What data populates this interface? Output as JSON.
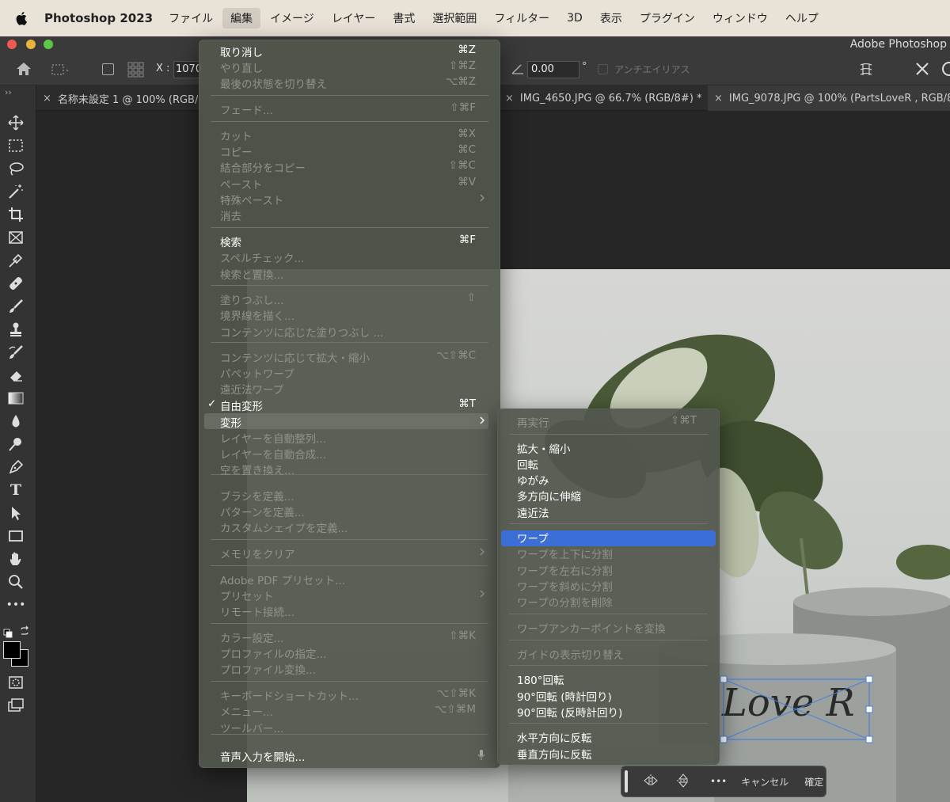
{
  "menubar": {
    "app_name": "Photoshop 2023",
    "items": [
      "ファイル",
      "編集",
      "イメージ",
      "レイヤー",
      "書式",
      "選択範囲",
      "フィルター",
      "3D",
      "表示",
      "プラグイン",
      "ウィンドウ",
      "ヘルプ"
    ]
  },
  "window": {
    "title": "Adobe Photoshop"
  },
  "options": {
    "x_label": "X :",
    "x_value": "1070.",
    "angle_value": "0.00",
    "degree": "°",
    "antialias": "アンチエイリアス"
  },
  "tabs": [
    {
      "close": "×",
      "label": "名称未設定 1 @ 100% (RGB/"
    },
    {
      "close": "×",
      "label": "IMG_4650.JPG @ 66.7% (RGB/8#) *"
    },
    {
      "close": "×",
      "label": "IMG_9078.JPG @ 100% (PartsLoveR , RGB/8"
    }
  ],
  "edit_menu": [
    {
      "label": "取り消し",
      "shortcut": "⌘Z",
      "enabled": true
    },
    {
      "label": "やり直し",
      "shortcut": "⇧⌘Z",
      "enabled": false
    },
    {
      "label": "最後の状態を切り替え",
      "shortcut": "⌥⌘Z",
      "enabled": false
    },
    {
      "label": "フェード...",
      "shortcut": "⇧⌘F",
      "enabled": false
    },
    {
      "label": "カット",
      "shortcut": "⌘X",
      "enabled": false
    },
    {
      "label": "コピー",
      "shortcut": "⌘C",
      "enabled": false
    },
    {
      "label": "結合部分をコピー",
      "shortcut": "⇧⌘C",
      "enabled": false
    },
    {
      "label": "ペースト",
      "shortcut": "⌘V",
      "enabled": false
    },
    {
      "label": "特殊ペースト",
      "shortcut": "",
      "enabled": false,
      "submenu": true
    },
    {
      "label": "消去",
      "shortcut": "",
      "enabled": false
    },
    {
      "label": "検索",
      "shortcut": "⌘F",
      "enabled": true
    },
    {
      "label": "スペルチェック...",
      "shortcut": "",
      "enabled": false
    },
    {
      "label": "検索と置換...",
      "shortcut": "",
      "enabled": false
    },
    {
      "label": "塗りつぶし...",
      "shortcut": "⇧",
      "enabled": false
    },
    {
      "label": "境界線を描く...",
      "shortcut": "",
      "enabled": false
    },
    {
      "label": "コンテンツに応じた塗りつぶし ...",
      "shortcut": "",
      "enabled": false
    },
    {
      "label": "コンテンツに応じて拡大・縮小",
      "shortcut": "⌥⇧⌘C",
      "enabled": false
    },
    {
      "label": "パペットワープ",
      "shortcut": "",
      "enabled": false
    },
    {
      "label": "遠近法ワープ",
      "shortcut": "",
      "enabled": false
    },
    {
      "label": "自由変形",
      "shortcut": "⌘T",
      "enabled": true,
      "checked": true,
      "check": "✓"
    },
    {
      "label": "変形",
      "shortcut": "",
      "enabled": true,
      "submenu": true,
      "highlight": true
    },
    {
      "label": "レイヤーを自動整列...",
      "shortcut": "",
      "enabled": false
    },
    {
      "label": "レイヤーを自動合成...",
      "shortcut": "",
      "enabled": false
    },
    {
      "label": "空を置き換え...",
      "shortcut": "",
      "enabled": false
    },
    {
      "label": "ブラシを定義...",
      "shortcut": "",
      "enabled": false
    },
    {
      "label": "パターンを定義...",
      "shortcut": "",
      "enabled": false
    },
    {
      "label": "カスタムシェイプを定義...",
      "shortcut": "",
      "enabled": false
    },
    {
      "label": "メモリをクリア",
      "shortcut": "",
      "enabled": false,
      "submenu": true
    },
    {
      "label": "Adobe PDF プリセット...",
      "shortcut": "",
      "enabled": false
    },
    {
      "label": "プリセット",
      "shortcut": "",
      "enabled": false,
      "submenu": true
    },
    {
      "label": "リモート接続...",
      "shortcut": "",
      "enabled": false
    },
    {
      "label": "カラー設定...",
      "shortcut": "⇧⌘K",
      "enabled": false
    },
    {
      "label": "プロファイルの指定...",
      "shortcut": "",
      "enabled": false
    },
    {
      "label": "プロファイル変換...",
      "shortcut": "",
      "enabled": false
    },
    {
      "label": "キーボードショートカット...",
      "shortcut": "⌥⇧⌘K",
      "enabled": false
    },
    {
      "label": "メニュー...",
      "shortcut": "⌥⇧⌘M",
      "enabled": false
    },
    {
      "label": "ツールバー...",
      "shortcut": "",
      "enabled": false
    },
    {
      "label": "音声入力を開始...",
      "shortcut": "",
      "enabled": true,
      "mic": true
    }
  ],
  "transform_submenu": [
    {
      "label": "再実行",
      "shortcut": "⇧⌘T",
      "enabled": false
    },
    {
      "label": "拡大・縮小",
      "shortcut": "",
      "enabled": true
    },
    {
      "label": "回転",
      "shortcut": "",
      "enabled": true
    },
    {
      "label": "ゆがみ",
      "shortcut": "",
      "enabled": true
    },
    {
      "label": "多方向に伸縮",
      "shortcut": "",
      "enabled": true
    },
    {
      "label": "遠近法",
      "shortcut": "",
      "enabled": true
    },
    {
      "label": "ワープ",
      "shortcut": "",
      "enabled": true,
      "highlight": true
    },
    {
      "label": "ワープを上下に分割",
      "shortcut": "",
      "enabled": false
    },
    {
      "label": "ワープを左右に分割",
      "shortcut": "",
      "enabled": false
    },
    {
      "label": "ワープを斜めに分割",
      "shortcut": "",
      "enabled": false
    },
    {
      "label": "ワープの分割を削除",
      "shortcut": "",
      "enabled": false
    },
    {
      "label": "ワープアンカーポイントを変換",
      "shortcut": "",
      "enabled": false
    },
    {
      "label": "ガイドの表示切り替え",
      "shortcut": "",
      "enabled": false
    },
    {
      "label": "180°回転",
      "shortcut": "",
      "enabled": true
    },
    {
      "label": "90°回転 (時計回り)",
      "shortcut": "",
      "enabled": true
    },
    {
      "label": "90°回転 (反時計回り)",
      "shortcut": "",
      "enabled": true
    },
    {
      "label": "水平方向に反転",
      "shortcut": "",
      "enabled": true
    },
    {
      "label": "垂直方向に反転",
      "shortcut": "",
      "enabled": true
    }
  ],
  "context_bar": {
    "more": "•••",
    "cancel": "キャンセル",
    "commit": "確定"
  },
  "canvas": {
    "text": "Love R"
  },
  "colors": {
    "highlight": "#3c6fd6",
    "menu_bg": "#52574e",
    "transform_box": "#4a7fe0"
  }
}
